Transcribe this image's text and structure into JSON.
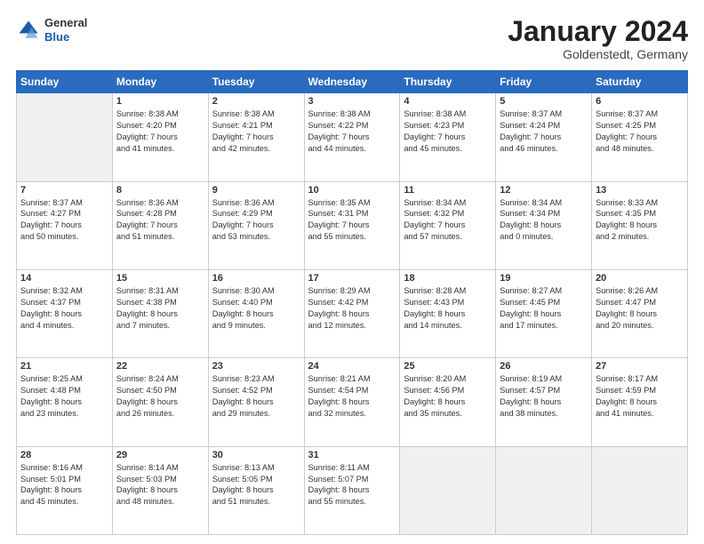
{
  "header": {
    "logo_general": "General",
    "logo_blue": "Blue",
    "month": "January 2024",
    "location": "Goldenstedt, Germany"
  },
  "days_of_week": [
    "Sunday",
    "Monday",
    "Tuesday",
    "Wednesday",
    "Thursday",
    "Friday",
    "Saturday"
  ],
  "weeks": [
    [
      {
        "day": "",
        "content": "",
        "shaded": true
      },
      {
        "day": "1",
        "content": "Sunrise: 8:38 AM\nSunset: 4:20 PM\nDaylight: 7 hours\nand 41 minutes."
      },
      {
        "day": "2",
        "content": "Sunrise: 8:38 AM\nSunset: 4:21 PM\nDaylight: 7 hours\nand 42 minutes."
      },
      {
        "day": "3",
        "content": "Sunrise: 8:38 AM\nSunset: 4:22 PM\nDaylight: 7 hours\nand 44 minutes."
      },
      {
        "day": "4",
        "content": "Sunrise: 8:38 AM\nSunset: 4:23 PM\nDaylight: 7 hours\nand 45 minutes."
      },
      {
        "day": "5",
        "content": "Sunrise: 8:37 AM\nSunset: 4:24 PM\nDaylight: 7 hours\nand 46 minutes."
      },
      {
        "day": "6",
        "content": "Sunrise: 8:37 AM\nSunset: 4:25 PM\nDaylight: 7 hours\nand 48 minutes."
      }
    ],
    [
      {
        "day": "7",
        "content": "Sunrise: 8:37 AM\nSunset: 4:27 PM\nDaylight: 7 hours\nand 50 minutes."
      },
      {
        "day": "8",
        "content": "Sunrise: 8:36 AM\nSunset: 4:28 PM\nDaylight: 7 hours\nand 51 minutes."
      },
      {
        "day": "9",
        "content": "Sunrise: 8:36 AM\nSunset: 4:29 PM\nDaylight: 7 hours\nand 53 minutes."
      },
      {
        "day": "10",
        "content": "Sunrise: 8:35 AM\nSunset: 4:31 PM\nDaylight: 7 hours\nand 55 minutes."
      },
      {
        "day": "11",
        "content": "Sunrise: 8:34 AM\nSunset: 4:32 PM\nDaylight: 7 hours\nand 57 minutes."
      },
      {
        "day": "12",
        "content": "Sunrise: 8:34 AM\nSunset: 4:34 PM\nDaylight: 8 hours\nand 0 minutes."
      },
      {
        "day": "13",
        "content": "Sunrise: 8:33 AM\nSunset: 4:35 PM\nDaylight: 8 hours\nand 2 minutes."
      }
    ],
    [
      {
        "day": "14",
        "content": "Sunrise: 8:32 AM\nSunset: 4:37 PM\nDaylight: 8 hours\nand 4 minutes."
      },
      {
        "day": "15",
        "content": "Sunrise: 8:31 AM\nSunset: 4:38 PM\nDaylight: 8 hours\nand 7 minutes."
      },
      {
        "day": "16",
        "content": "Sunrise: 8:30 AM\nSunset: 4:40 PM\nDaylight: 8 hours\nand 9 minutes."
      },
      {
        "day": "17",
        "content": "Sunrise: 8:29 AM\nSunset: 4:42 PM\nDaylight: 8 hours\nand 12 minutes."
      },
      {
        "day": "18",
        "content": "Sunrise: 8:28 AM\nSunset: 4:43 PM\nDaylight: 8 hours\nand 14 minutes."
      },
      {
        "day": "19",
        "content": "Sunrise: 8:27 AM\nSunset: 4:45 PM\nDaylight: 8 hours\nand 17 minutes."
      },
      {
        "day": "20",
        "content": "Sunrise: 8:26 AM\nSunset: 4:47 PM\nDaylight: 8 hours\nand 20 minutes."
      }
    ],
    [
      {
        "day": "21",
        "content": "Sunrise: 8:25 AM\nSunset: 4:48 PM\nDaylight: 8 hours\nand 23 minutes."
      },
      {
        "day": "22",
        "content": "Sunrise: 8:24 AM\nSunset: 4:50 PM\nDaylight: 8 hours\nand 26 minutes."
      },
      {
        "day": "23",
        "content": "Sunrise: 8:23 AM\nSunset: 4:52 PM\nDaylight: 8 hours\nand 29 minutes."
      },
      {
        "day": "24",
        "content": "Sunrise: 8:21 AM\nSunset: 4:54 PM\nDaylight: 8 hours\nand 32 minutes."
      },
      {
        "day": "25",
        "content": "Sunrise: 8:20 AM\nSunset: 4:56 PM\nDaylight: 8 hours\nand 35 minutes."
      },
      {
        "day": "26",
        "content": "Sunrise: 8:19 AM\nSunset: 4:57 PM\nDaylight: 8 hours\nand 38 minutes."
      },
      {
        "day": "27",
        "content": "Sunrise: 8:17 AM\nSunset: 4:59 PM\nDaylight: 8 hours\nand 41 minutes."
      }
    ],
    [
      {
        "day": "28",
        "content": "Sunrise: 8:16 AM\nSunset: 5:01 PM\nDaylight: 8 hours\nand 45 minutes."
      },
      {
        "day": "29",
        "content": "Sunrise: 8:14 AM\nSunset: 5:03 PM\nDaylight: 8 hours\nand 48 minutes."
      },
      {
        "day": "30",
        "content": "Sunrise: 8:13 AM\nSunset: 5:05 PM\nDaylight: 8 hours\nand 51 minutes."
      },
      {
        "day": "31",
        "content": "Sunrise: 8:11 AM\nSunset: 5:07 PM\nDaylight: 8 hours\nand 55 minutes."
      },
      {
        "day": "",
        "content": "",
        "shaded": true
      },
      {
        "day": "",
        "content": "",
        "shaded": true
      },
      {
        "day": "",
        "content": "",
        "shaded": true
      }
    ]
  ]
}
